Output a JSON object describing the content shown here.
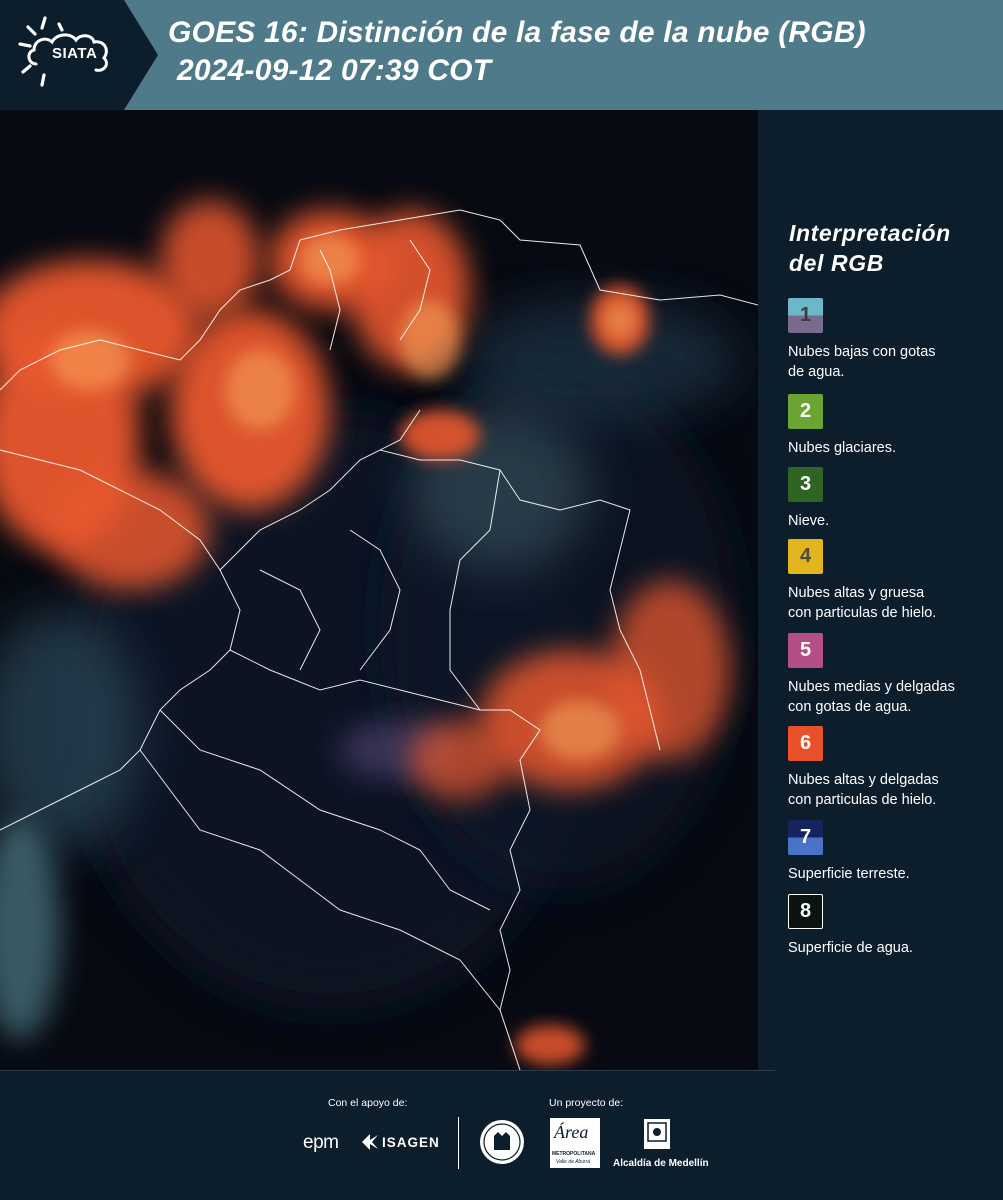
{
  "header": {
    "logo_text": "SIATA",
    "title_line1": "GOES 16: Distinción de la fase de la nube (RGB)",
    "title_line2": "2024-09-12 07:39 COT"
  },
  "legend": {
    "title_line1": "Interpretación",
    "title_line2": "del RGB",
    "items": [
      {
        "number": "1",
        "label_line1": "Nubes bajas con gotas",
        "label_line2": "de agua.",
        "color_top": "#6cb8c8",
        "color_bottom": "#7a6b8c",
        "num_color": "#3c3c3c"
      },
      {
        "number": "2",
        "label_line1": "Nubes glaciares.",
        "label_line2": "",
        "color_top": "#6aa432",
        "color_bottom": "#6aa432",
        "num_color": "#ffffff"
      },
      {
        "number": "3",
        "label_line1": "Nieve.",
        "label_line2": "",
        "color_top": "#2f6422",
        "color_bottom": "#2f6422",
        "num_color": "#ffffff"
      },
      {
        "number": "4",
        "label_line1": "Nubes altas y gruesa",
        "label_line2": "con particulas de hielo.",
        "color_top": "#e3b51c",
        "color_bottom": "#e3b51c",
        "num_color": "#4a4a4a"
      },
      {
        "number": "5",
        "label_line1": "Nubes medias y delgadas",
        "label_line2": "con gotas de agua.",
        "color_top": "#b44e85",
        "color_bottom": "#b44e85",
        "num_color": "#ffffff"
      },
      {
        "number": "6",
        "label_line1": "Nubes altas y delgadas",
        "label_line2": "con particulas de hielo.",
        "color_top": "#e9512a",
        "color_bottom": "#e9512a",
        "num_color": "#ffffff"
      },
      {
        "number": "7",
        "label_line1": "Superficie terreste.",
        "label_line2": "",
        "color_top": "#13245e",
        "color_bottom": "#4a72c6",
        "num_color": "#ffffff"
      },
      {
        "number": "8",
        "label_line1": "Superficie de agua.",
        "label_line2": "",
        "color_top": "#0b1410",
        "color_bottom": "#0b1410",
        "num_color": "#ffffff"
      }
    ]
  },
  "footer": {
    "support_label": "Con el apoyo de:",
    "project_label": "Un proyecto de:",
    "sponsor_epm": "epm",
    "sponsor_isagen": "ISAGEN",
    "sponsor_area": "Área",
    "sponsor_area_sub1": "METROPOLITANA",
    "sponsor_area_sub2": "Valle de Aburrá",
    "sponsor_alcaldia": "Alcaldía de Medellín"
  },
  "colors": {
    "header_bg": "#4f7a89",
    "panel_bg": "#0c1d2b",
    "cloud_ice": "#e9512a"
  }
}
